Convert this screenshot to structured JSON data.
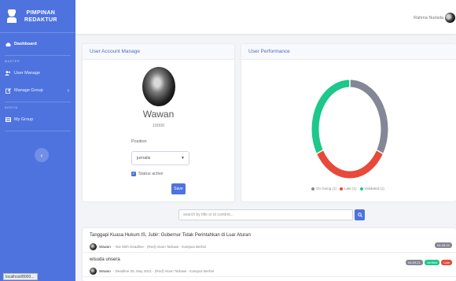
{
  "sidebar": {
    "brand": {
      "line1": "PIMPINAN",
      "line2": "REDAKTUR"
    },
    "dashboard": "Dashboard",
    "heading_master": "MASTER",
    "user_manage": "User Manage",
    "manage_group": "Manage Group",
    "heading_berita": "BERITA",
    "my_group": "My Group"
  },
  "status_bar": {
    "url": "localhost/8000..."
  },
  "topbar": {
    "user_name": "Rahma Nurlaila"
  },
  "account": {
    "header": "User Account Manage",
    "name": "Wawan",
    "id": "10000",
    "position_label": "Position",
    "position_value": "jurnalis",
    "status_label": "Status active",
    "save_label": "Save"
  },
  "performance": {
    "header": "User Performance",
    "legend": [
      {
        "label": "On Going (1)",
        "color": "#858796"
      },
      {
        "label": "Late (1)",
        "color": "#e74a3b"
      },
      {
        "label": "Validated (1)",
        "color": "#1cc88a"
      }
    ]
  },
  "chart_data": {
    "type": "pie",
    "categories": [
      "On Going",
      "Late",
      "Validated"
    ],
    "values": [
      1,
      1,
      1
    ],
    "colors": [
      "#858796",
      "#e74a3b",
      "#1cc88a"
    ]
  },
  "search": {
    "placeholder": "search by title or id content..."
  },
  "items": [
    {
      "title": "Tanggapi Kuasa Hukum IS, Jubir: Gubernur Tidak Perintahkan di Luar Aturan",
      "author": "Wawan",
      "meta": "- Not With Deadline - (Red) Imam Tarbawi - Kampus Berfari",
      "badges": [
        {
          "text": "04-09-21",
          "color": "#858796"
        }
      ]
    },
    {
      "title": "wisuda unsera",
      "author": "Wawan",
      "meta": "- Deadline 25, May 2021 - (Red) Imam Tarbawi - Kampus Berfari",
      "badges": [
        {
          "text": "04-09-21",
          "color": "#858796"
        },
        {
          "text": "Verified",
          "color": "#1cc88a"
        },
        {
          "text": "Late",
          "color": "#e74a3b"
        }
      ]
    }
  ]
}
